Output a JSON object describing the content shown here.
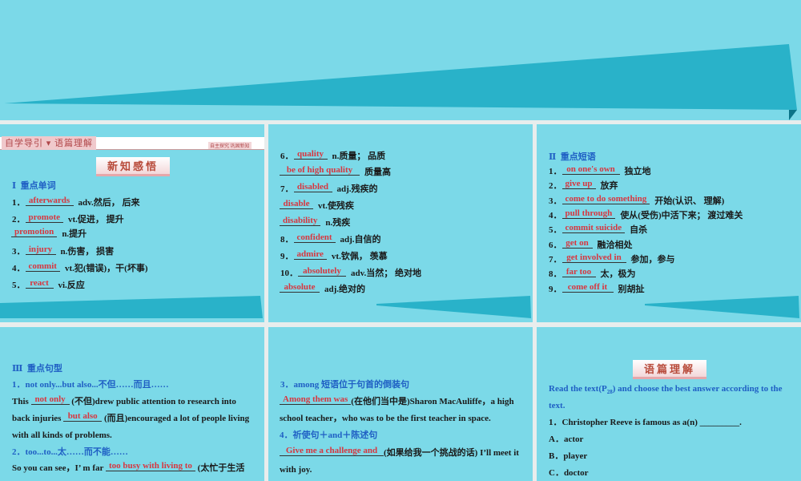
{
  "colors": {
    "background": "#7bd9e8",
    "wedge": "#29b2c9",
    "answer": "#d8363f",
    "heading": "#1f5fc4"
  },
  "header": {
    "left_tab": "自学导引 ▾ 语篇理解",
    "right_tab": "自主探究 巩固新知",
    "section_badge": "新知感悟"
  },
  "words": {
    "heading_num": "Ⅰ",
    "heading": "重点单词",
    "items": [
      {
        "num": "1．",
        "ans": "afterwards",
        "def": "adv.然后， 后来"
      },
      {
        "num": "2．",
        "ans": "promote",
        "def": "vt.促进， 提升"
      },
      {
        "num": "",
        "ans": "promotion",
        "def": "n.提升"
      },
      {
        "num": "3．",
        "ans": "injury",
        "def": "n.伤害， 损害"
      },
      {
        "num": "4．",
        "ans": "commit",
        "def": "vt.犯(错误)，干(坏事)"
      },
      {
        "num": "5．",
        "ans": "react",
        "def": "vi.反应"
      },
      {
        "num": "6．",
        "ans": "quality",
        "def": "n.质量； 品质"
      },
      {
        "num": "",
        "ans": "be of high quality",
        "def": "质量高"
      },
      {
        "num": "7．",
        "ans": "disabled",
        "def": "adj.残疾的"
      },
      {
        "num": "",
        "ans": "disable",
        "def": "vt.使残疾"
      },
      {
        "num": "",
        "ans": "disability",
        "def": "n.残疾"
      },
      {
        "num": "8．",
        "ans": "confident",
        "def": "adj.自信的"
      },
      {
        "num": "9．",
        "ans": "admire",
        "def": "vt.钦佩， 羡慕"
      },
      {
        "num": "10．",
        "ans": "absolutely",
        "def": "adv.当然； 绝对地"
      },
      {
        "num": "",
        "ans": "absolute",
        "def": "adj.绝对的"
      }
    ]
  },
  "phrases": {
    "heading_num": "Ⅱ",
    "heading": "重点短语",
    "items": [
      {
        "num": "1．",
        "ans": "on one's own",
        "def": "独立地"
      },
      {
        "num": "2．",
        "ans": "give up",
        "def": "放弃"
      },
      {
        "num": "3．",
        "ans": "come to do something",
        "def": "开始(认识、 理解)"
      },
      {
        "num": "4．",
        "ans": "pull through",
        "def": "使从(受伤)中活下来； 渡过难关"
      },
      {
        "num": "5．",
        "ans": "commit suicide",
        "def": "自杀"
      },
      {
        "num": "6．",
        "ans": "get on",
        "def": "融洽相处"
      },
      {
        "num": "7．",
        "ans": "get involved in",
        "def": "参加，参与"
      },
      {
        "num": "8．",
        "ans": "far too",
        "def": "太，极为"
      },
      {
        "num": "9．",
        "ans": "come off it",
        "def": "别胡扯"
      }
    ]
  },
  "sentences": {
    "heading_num": "Ⅲ",
    "heading": "重点句型",
    "p1_title": "1．not only...but also...不但……而且……",
    "p1_a": "This",
    "p1_ans1": "not only",
    "p1_b": "(不但)drew public attention to research into",
    "p1_c": "back injuries",
    "p1_ans2": "but also",
    "p1_d": "(而且)encouraged a lot of people living",
    "p1_e": "with all kinds of problems.",
    "p2_title": "2．too...to...太……而不能……",
    "p2_a": "So you can see，I’ m far",
    "p2_ans": "too busy with living to",
    "p2_b": "(太忙于生活",
    "p3_title": "3．among 短语位于句首的倒装句",
    "p3_ans": "Among them was",
    "p3_a": "(在他们当中是)Sharon MacAuliffe，a high",
    "p3_b": "school teacher，who was to be the first teacher in space.",
    "p4_title": "4．祈使句＋and＋陈述句",
    "p4_ans": "Give me a challenge and",
    "p4_a": "(如果给我一个挑战的话) I’ll meet it",
    "p4_b": "with joy."
  },
  "reading": {
    "badge": "语篇理解",
    "instr_a": "Read the text(P",
    "instr_sub": "28",
    "instr_b": ") and choose the best answer according to the",
    "instr_c": "text.",
    "q1": "1．Christopher Reeve is famous as a(n) _________.",
    "options": [
      "A．actor",
      "B．player",
      "C．doctor"
    ]
  }
}
